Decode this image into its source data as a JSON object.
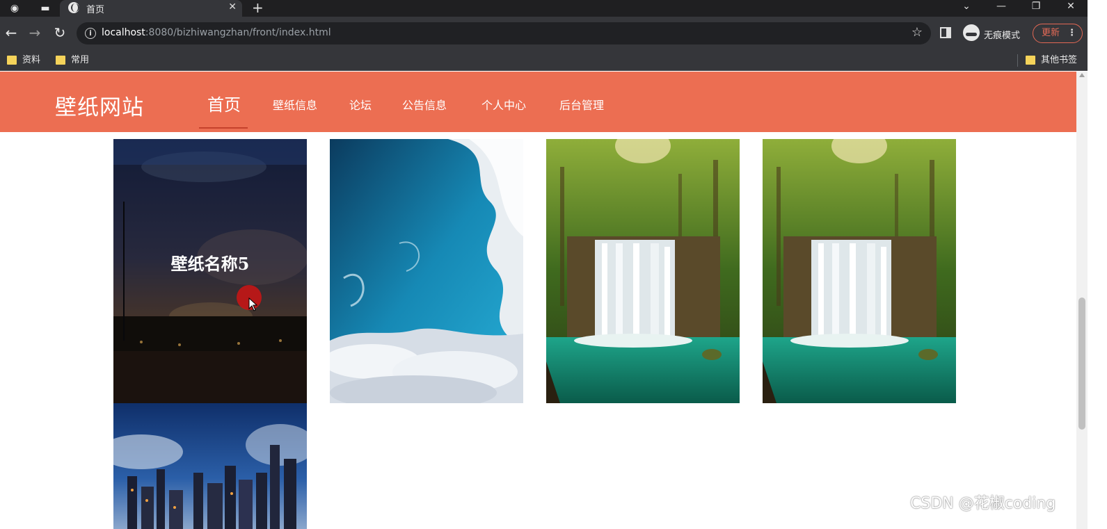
{
  "browser": {
    "tab_title": "首页",
    "url_host": "localhost",
    "url_rest": ":8080/bizhiwangzhan/front/index.html",
    "incognito_label": "无痕模式",
    "update_label": "更新",
    "bookmarks": [
      "资料",
      "常用"
    ],
    "other_bookmarks": "其他书签"
  },
  "site": {
    "brand": "壁纸网站",
    "nav": [
      {
        "label": "首页",
        "active": true
      },
      {
        "label": "壁纸信息"
      },
      {
        "label": "论坛"
      },
      {
        "label": "公告信息"
      },
      {
        "label": "个人中心"
      },
      {
        "label": "后台管理"
      }
    ],
    "accent_color": "#ec6e52"
  },
  "wallpapers": [
    {
      "caption": "壁纸名称5",
      "scene": "night-harbor",
      "hovered": true
    },
    {
      "scene": "sky-clouds"
    },
    {
      "scene": "forest-waterfall"
    },
    {
      "scene": "forest-waterfall"
    },
    {
      "scene": "city-skyline"
    }
  ],
  "watermark": "CSDN @花椒coding"
}
